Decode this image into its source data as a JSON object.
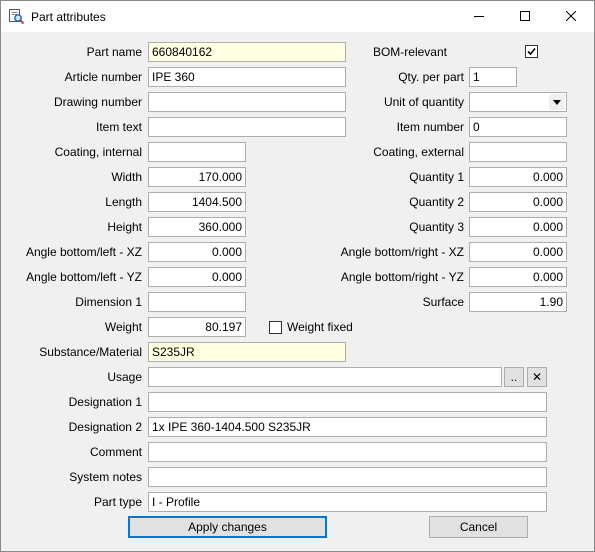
{
  "window": {
    "title": "Part attributes"
  },
  "icons": {
    "app": "magnifier-document-icon",
    "minimize": "minimize-icon",
    "maximize": "maximize-icon",
    "close": "close-icon",
    "checkmark": "checkmark-icon",
    "dropdown": "chevron-down-icon",
    "clear": "x-icon"
  },
  "colors": {
    "required_field": "#ffffe1",
    "default_button_border": "#0078d7"
  },
  "left": {
    "part_name": {
      "label": "Part name",
      "value": "660840162"
    },
    "article_number": {
      "label": "Article number",
      "value": "IPE 360"
    },
    "drawing_number": {
      "label": "Drawing number",
      "value": ""
    },
    "item_text": {
      "label": "Item text",
      "value": ""
    },
    "coating_internal": {
      "label": "Coating, internal",
      "value": ""
    },
    "width": {
      "label": "Width",
      "value": "170.000"
    },
    "length": {
      "label": "Length",
      "value": "1404.500"
    },
    "height": {
      "label": "Height",
      "value": "360.000"
    },
    "angle_bl_xz": {
      "label": "Angle bottom/left - XZ",
      "value": "0.000"
    },
    "angle_bl_yz": {
      "label": "Angle bottom/left - YZ",
      "value": "0.000"
    },
    "dimension1": {
      "label": "Dimension 1",
      "value": ""
    },
    "weight": {
      "label": "Weight",
      "value": "80.197"
    },
    "weight_fixed": {
      "label": "Weight fixed",
      "checked": false
    },
    "substance": {
      "label": "Substance/Material",
      "value": "S235JR"
    }
  },
  "right": {
    "bom_relevant": {
      "label": "BOM-relevant",
      "checked": true
    },
    "qty_per_part": {
      "label": "Qty. per part",
      "value": "1"
    },
    "unit_of_quantity": {
      "label": "Unit of quantity",
      "value": ""
    },
    "item_number": {
      "label": "Item number",
      "value": "0"
    },
    "coating_external": {
      "label": "Coating, external",
      "value": ""
    },
    "quantity1": {
      "label": "Quantity 1",
      "value": "0.000"
    },
    "quantity2": {
      "label": "Quantity 2",
      "value": "0.000"
    },
    "quantity3": {
      "label": "Quantity 3",
      "value": "0.000"
    },
    "angle_br_xz": {
      "label": "Angle bottom/right - XZ",
      "value": "0.000"
    },
    "angle_br_yz": {
      "label": "Angle bottom/right - YZ",
      "value": "0.000"
    },
    "surface": {
      "label": "Surface",
      "value": "1.90"
    }
  },
  "bottom": {
    "usage": {
      "label": "Usage",
      "value": "",
      "browse_label": "..",
      "clear_label": "✕"
    },
    "designation1": {
      "label": "Designation 1",
      "value": ""
    },
    "designation2": {
      "label": "Designation 2",
      "value": "1x IPE 360-1404.500 S235JR"
    },
    "comment": {
      "label": "Comment",
      "value": ""
    },
    "system_notes": {
      "label": "System notes",
      "value": ""
    },
    "part_type": {
      "label": "Part type",
      "value": "I - Profile"
    }
  },
  "buttons": {
    "apply": "Apply changes",
    "cancel": "Cancel"
  }
}
